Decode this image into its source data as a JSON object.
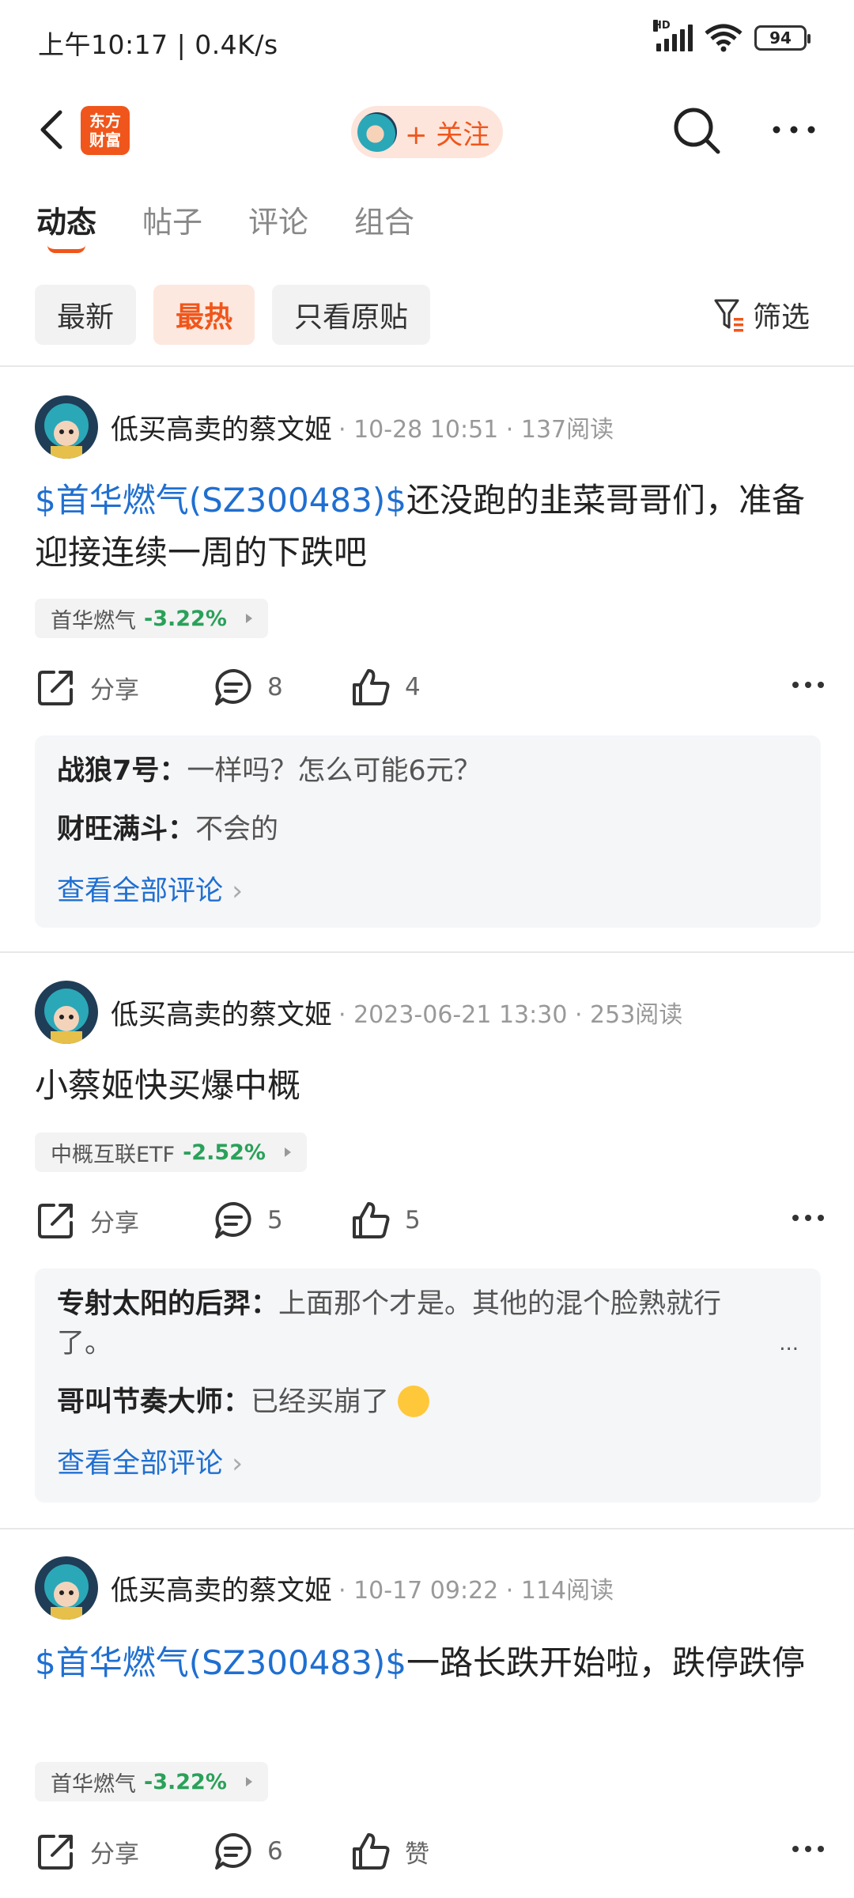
{
  "status_bar": {
    "time": "上午10:17 | 0.4K/s",
    "hd": "HD",
    "battery": "94"
  },
  "header": {
    "logo_text": "东方\n财富",
    "follow_label": "+ 关注"
  },
  "tabs": [
    {
      "label": "动态"
    },
    {
      "label": "帖子"
    },
    {
      "label": "评论"
    },
    {
      "label": "组合"
    }
  ],
  "filters": {
    "chips": [
      "最新",
      "最热",
      "只看原贴"
    ],
    "filter_label": "筛选"
  },
  "posts": [
    {
      "author": "低买高卖的蔡文姬",
      "meta": "· 10-28 10:51 · 137阅读",
      "stock_link": "$首华燃气(SZ300483)$",
      "text": "还没跑的韭菜哥哥们，准备迎接连续一周的下跌吧",
      "tag": {
        "name": "首华燃气",
        "change": "-3.22%"
      },
      "share": "分享",
      "comments_count": "8",
      "likes": "4",
      "comments": [
        {
          "user": "战狼7号：",
          "text": "一样吗？怎么可能6元？"
        },
        {
          "user": "财旺满斗：",
          "text": "不会的"
        }
      ],
      "view_all": "查看全部评论"
    },
    {
      "author": "低买高卖的蔡文姬",
      "meta": "· 2023-06-21 13:30 · 253阅读",
      "stock_link": "",
      "text": "小蔡姬快买爆中概",
      "tag": {
        "name": "中概互联ETF",
        "change": "-2.52%"
      },
      "share": "分享",
      "comments_count": "5",
      "likes": "5",
      "comments": [
        {
          "user": "专射太阳的后羿：",
          "text": "上面那个才是。其他的混个脸熟就行了。"
        },
        {
          "user": "哥叫节奏大师：",
          "text": "已经买崩了"
        }
      ],
      "ellipsis": "...",
      "view_all": "查看全部评论"
    },
    {
      "author": "低买高卖的蔡文姬",
      "meta": "· 10-17 09:22 · 114阅读",
      "stock_link": "$首华燃气(SZ300483)$",
      "text": "一路长跌开始啦，跌停跌停",
      "tag": {
        "name": "首华燃气",
        "change": "-3.22%"
      },
      "share": "分享",
      "comments_count": "6",
      "likes": "赞"
    }
  ]
}
